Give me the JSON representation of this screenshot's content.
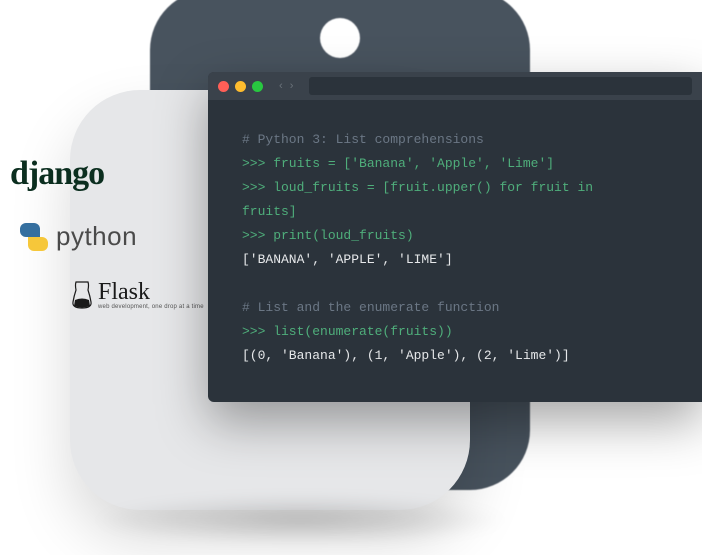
{
  "logos": {
    "django": "django",
    "python": "python",
    "flask": {
      "main": "Flask",
      "sub": "web development, one drop at a time"
    }
  },
  "terminal": {
    "arrows": "‹ ›",
    "lines": [
      {
        "cls": "c-comment",
        "text": "# Python 3: List comprehensions"
      },
      {
        "cls": "c-prompt",
        "text": ">>> fruits = ['Banana', 'Apple', 'Lime']"
      },
      {
        "cls": "c-prompt",
        "text": ">>> loud_fruits = [fruit.upper() for fruit in"
      },
      {
        "cls": "c-prompt",
        "text": "fruits]"
      },
      {
        "cls": "c-prompt",
        "text": ">>> print(loud_fruits)"
      },
      {
        "cls": "c-out",
        "text": "['BANANA', 'APPLE', 'LIME']"
      },
      {
        "cls": "",
        "text": ""
      },
      {
        "cls": "c-comment",
        "text": "# List and the enumerate function"
      },
      {
        "cls": "c-prompt",
        "text": ">>> list(enumerate(fruits))"
      },
      {
        "cls": "c-out",
        "text": "[(0, 'Banana'), (1, 'Apple'), (2, 'Lime')]"
      }
    ]
  }
}
